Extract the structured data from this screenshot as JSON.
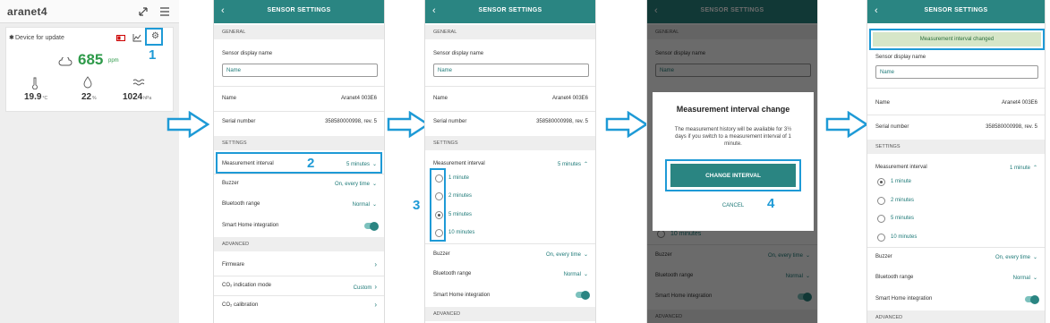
{
  "panel1": {
    "brand": "aranet4",
    "device_name": "Device for update",
    "co2_value": "685",
    "co2_unit": "ppm",
    "temperature": "19.9",
    "temperature_unit": "°C",
    "humidity": "22",
    "humidity_unit": "%",
    "pressure": "1024",
    "pressure_unit": "hPa"
  },
  "screen": {
    "title": "SENSOR SETTINGS",
    "general_section": "GENERAL",
    "display_name_label": "Sensor display name",
    "display_name_placeholder": "Name",
    "name_label": "Name",
    "name_value": "Aranet4 003E6",
    "serial_label": "Serial number",
    "serial_value": "358580000998, rev. 5",
    "settings_section": "SETTINGS",
    "interval_label": "Measurement interval",
    "interval_value": "5 minutes",
    "buzzer_label": "Buzzer",
    "buzzer_value": "On, every time",
    "bt_label": "Bluetooth range",
    "bt_value": "Normal",
    "smarthome_label": "Smart Home integration",
    "advanced_section": "ADVANCED",
    "firmware_label": "Firmware",
    "co2_mode_label": "CO₂ indication mode",
    "co2_mode_value": "Custom",
    "co2_calib_label": "CO₂ calibration"
  },
  "options": [
    "1 minute",
    "2 minutes",
    "5 minutes",
    "10 minutes"
  ],
  "dialog": {
    "title": "Measurement interval change",
    "body": "The measurement history will be available for 3½ days if you switch to a measurement interval of 1 minute.",
    "confirm": "CHANGE INTERVAL",
    "cancel": "CANCEL"
  },
  "result": {
    "banner": "Measurement interval changed",
    "interval_value": "1 minute"
  },
  "steps": [
    "1",
    "2",
    "3",
    "4"
  ],
  "colors": {
    "header": "#2a8582",
    "highlight": "#1e9ad6",
    "co2": "#2e9a4a"
  }
}
